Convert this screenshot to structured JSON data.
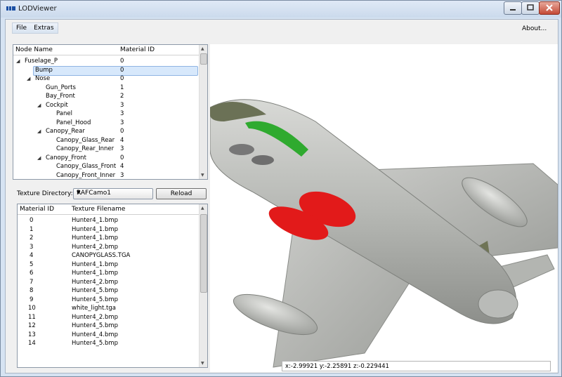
{
  "window": {
    "title": "LODViewer",
    "icon": "lod-app-icon",
    "controls": [
      "minimize-icon",
      "maximize-icon",
      "close-icon"
    ]
  },
  "menu": {
    "file": "File",
    "extras": "Extras",
    "about": "About..."
  },
  "tree": {
    "headers": {
      "name": "Node Name",
      "material": "Material ID"
    },
    "selected": "Bump",
    "rows": [
      {
        "name": "Fuselage_P",
        "id": "0",
        "expanded": true
      },
      {
        "name": "Bump",
        "id": "0"
      },
      {
        "name": "Nose",
        "id": "0",
        "expanded": true
      },
      {
        "name": "Gun_Ports",
        "id": "1"
      },
      {
        "name": "Bay_Front",
        "id": "2"
      },
      {
        "name": "Cockpit",
        "id": "3",
        "expanded": true
      },
      {
        "name": "Panel",
        "id": "3"
      },
      {
        "name": "Panel_Hood",
        "id": "3"
      },
      {
        "name": "Canopy_Rear",
        "id": "0",
        "expanded": true
      },
      {
        "name": "Canopy_Glass_Rear",
        "id": "4"
      },
      {
        "name": "Canopy_Rear_Inner",
        "id": "3"
      },
      {
        "name": "Canopy_Front",
        "id": "0",
        "expanded": true
      },
      {
        "name": "Canopy_Glass_Front",
        "id": "4"
      },
      {
        "name": "Canopy_Front_Inner",
        "id": "3"
      }
    ]
  },
  "texture": {
    "label": "Texture Directory:",
    "directory": "RAFCamo1",
    "reload": "Reload",
    "headers": {
      "id": "Material ID",
      "file": "Texture Filename"
    },
    "rows": [
      {
        "id": "0",
        "file": "Hunter4_1.bmp"
      },
      {
        "id": "1",
        "file": "Hunter4_1.bmp"
      },
      {
        "id": "2",
        "file": "Hunter4_1.bmp"
      },
      {
        "id": "3",
        "file": "Hunter4_2.bmp"
      },
      {
        "id": "4",
        "file": "CANOPYGLASS.TGA"
      },
      {
        "id": "5",
        "file": "Hunter4_1.bmp"
      },
      {
        "id": "6",
        "file": "Hunter4_1.bmp"
      },
      {
        "id": "7",
        "file": "Hunter4_2.bmp"
      },
      {
        "id": "8",
        "file": "Hunter4_5.bmp"
      },
      {
        "id": "9",
        "file": "Hunter4_5.bmp"
      },
      {
        "id": "10",
        "file": "white_light.tga"
      },
      {
        "id": "11",
        "file": "Hunter4_2.bmp"
      },
      {
        "id": "12",
        "file": "Hunter4_5.bmp"
      },
      {
        "id": "13",
        "file": "Hunter4_4.bmp"
      },
      {
        "id": "14",
        "file": "Hunter4_5.bmp"
      }
    ]
  },
  "status": {
    "coords": "x:-2.99921 y:-2.25891 z:-0.229441"
  },
  "colors": {
    "accent": "#d7e8fb",
    "frame": "#d6e3f2",
    "fuselage": "#b9bbb8",
    "roundel": "#e21a1a",
    "canopy": "#2bb02b"
  }
}
